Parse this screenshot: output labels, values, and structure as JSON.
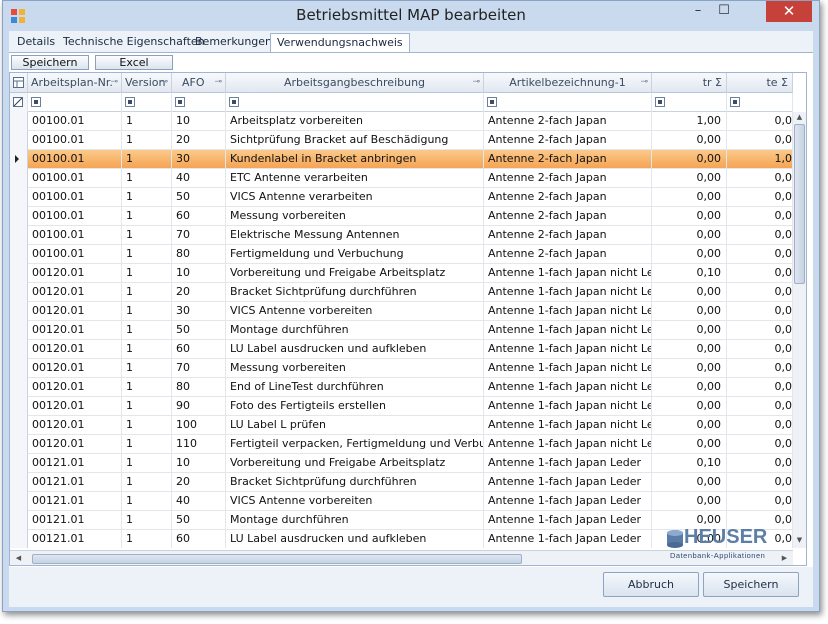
{
  "window": {
    "title": "Betriebsmittel MAP bearbeiten"
  },
  "title_buttons": {
    "minimize": "–",
    "maximize": "☐",
    "close": "✕"
  },
  "tabs": [
    {
      "label": "Details"
    },
    {
      "label": "Technische Eigenschaften"
    },
    {
      "label": "Bemerkungen"
    },
    {
      "label": "Verwendungsnachweis",
      "active": true
    }
  ],
  "toolbar": {
    "save_label": "Speichern",
    "excel_label": "Excel"
  },
  "grid": {
    "columns": [
      "Arbeitsplan-Nr.",
      "Version",
      "AFO",
      "Arbeitsgangbeschreibung",
      "Artikelbezeichnung-1",
      "tr Σ",
      "te Σ"
    ],
    "selected_row": 2,
    "rows": [
      [
        "00100.01",
        "1",
        "10",
        "Arbeitsplatz vorbereiten",
        "Antenne 2-fach Japan",
        "1,00",
        "0,0"
      ],
      [
        "00100.01",
        "1",
        "20",
        "Sichtprüfung Bracket auf Beschädigung",
        "Antenne 2-fach Japan",
        "0,00",
        "0,0"
      ],
      [
        "00100.01",
        "1",
        "30",
        "Kundenlabel in Bracket anbringen",
        "Antenne 2-fach Japan",
        "0,00",
        "1,0"
      ],
      [
        "00100.01",
        "1",
        "40",
        "ETC Antenne verarbeiten",
        "Antenne 2-fach Japan",
        "0,00",
        "0,0"
      ],
      [
        "00100.01",
        "1",
        "50",
        "VICS Antenne verarbeiten",
        "Antenne 2-fach Japan",
        "0,00",
        "0,0"
      ],
      [
        "00100.01",
        "1",
        "60",
        "Messung vorbereiten",
        "Antenne 2-fach Japan",
        "0,00",
        "0,0"
      ],
      [
        "00100.01",
        "1",
        "70",
        "Elektrische Messung Antennen",
        "Antenne 2-fach Japan",
        "0,00",
        "0,0"
      ],
      [
        "00100.01",
        "1",
        "80",
        "Fertigmeldung und Verbuchung",
        "Antenne 2-fach Japan",
        "0,00",
        "0,0"
      ],
      [
        "00120.01",
        "1",
        "10",
        "Vorbereitung und Freigabe Arbeitsplatz",
        "Antenne 1-fach Japan nicht Leder",
        "0,10",
        "0,0"
      ],
      [
        "00120.01",
        "1",
        "20",
        "Bracket Sichtprüfung durchführen",
        "Antenne 1-fach Japan nicht Leder",
        "0,00",
        "0,0"
      ],
      [
        "00120.01",
        "1",
        "30",
        "VICS Antenne vorbereiten",
        "Antenne 1-fach Japan nicht Leder",
        "0,00",
        "0,0"
      ],
      [
        "00120.01",
        "1",
        "50",
        "Montage durchführen",
        "Antenne 1-fach Japan nicht Leder",
        "0,00",
        "0,0"
      ],
      [
        "00120.01",
        "1",
        "60",
        "LU Label ausdrucken und aufkleben",
        "Antenne 1-fach Japan nicht Leder",
        "0,00",
        "0,0"
      ],
      [
        "00120.01",
        "1",
        "70",
        "Messung vorbereiten",
        "Antenne 1-fach Japan nicht Leder",
        "0,00",
        "0,0"
      ],
      [
        "00120.01",
        "1",
        "80",
        "End of LineTest durchführen",
        "Antenne 1-fach Japan nicht Leder",
        "0,00",
        "0,0"
      ],
      [
        "00120.01",
        "1",
        "90",
        "Foto des Fertigteils erstellen",
        "Antenne 1-fach Japan nicht Leder",
        "0,00",
        "0,0"
      ],
      [
        "00120.01",
        "1",
        "100",
        "LU Label L prüfen",
        "Antenne 1-fach Japan nicht Leder",
        "0,00",
        "0,0"
      ],
      [
        "00120.01",
        "1",
        "110",
        "Fertigteil verpacken, Fertigmeldung und Verbuchung",
        "Antenne 1-fach Japan nicht Leder",
        "0,00",
        "0,0"
      ],
      [
        "00121.01",
        "1",
        "10",
        "Vorbereitung und Freigabe Arbeitsplatz",
        "Antenne 1-fach Japan Leder",
        "0,10",
        "0,0"
      ],
      [
        "00121.01",
        "1",
        "20",
        "Bracket Sichtprüfung durchführen",
        "Antenne 1-fach Japan Leder",
        "0,00",
        "0,0"
      ],
      [
        "00121.01",
        "1",
        "40",
        "VICS Antenne vorbereiten",
        "Antenne 1-fach Japan Leder",
        "0,00",
        "0,0"
      ],
      [
        "00121.01",
        "1",
        "50",
        "Montage durchführen",
        "Antenne 1-fach Japan Leder",
        "0,00",
        "0,0"
      ],
      [
        "00121.01",
        "1",
        "60",
        "LU Label ausdrucken und aufkleben",
        "Antenne 1-fach Japan Leder",
        "0,00",
        "0,0"
      ]
    ]
  },
  "logo": {
    "main": "HEUSER",
    "sub": "Datenbank-Applikationen"
  },
  "buttons": {
    "cancel": "Abbruch",
    "save": "Speichern"
  },
  "colors": {
    "selected_row": "#f5a453",
    "close_button": "#c7413b",
    "window_frame": "#c9d9ee"
  }
}
